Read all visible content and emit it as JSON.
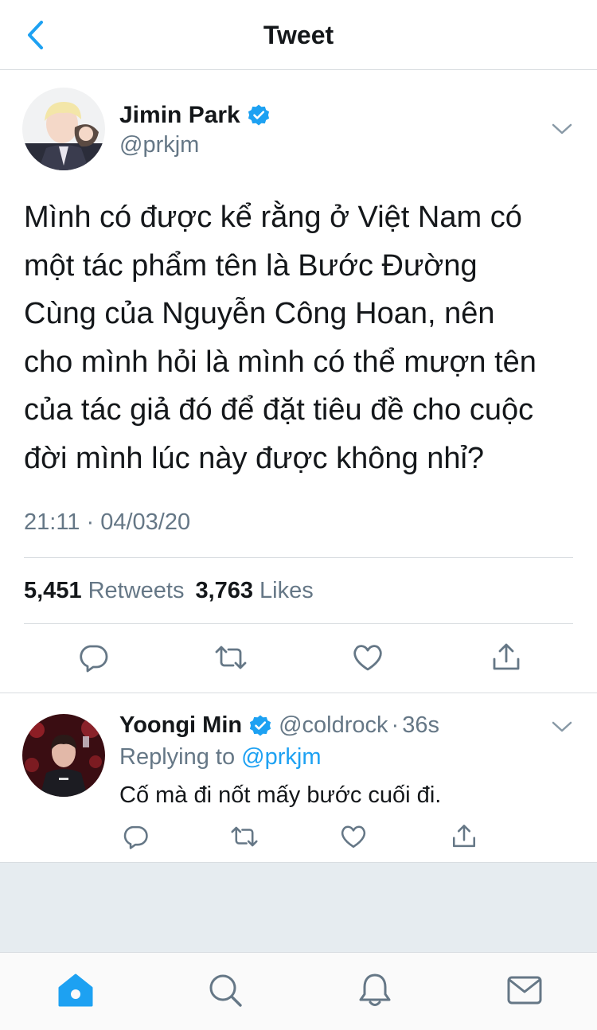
{
  "header": {
    "title": "Tweet"
  },
  "colors": {
    "accent": "#1da1f2",
    "text": "#14171a",
    "muted": "#657786",
    "divider": "#d9dde1",
    "background_gray": "#e6ecf0"
  },
  "tweet": {
    "author_name": "Jimin Park",
    "author_handle": "@prkjm",
    "verified": true,
    "lines": [
      "Mình có được kể rằng ở Việt Nam có",
      "một tác phẩm tên là Bước Đường",
      "Cùng của Nguyễn Công Hoan, nên",
      "cho mình hỏi là mình có thể mượn tên",
      "của tác giả đó để đặt tiêu đề cho cuộc",
      "đời mình lúc này được không nhỉ?"
    ],
    "timestamp": "21:11 · 04/03/20",
    "retweet_count": "5,451",
    "retweet_label": "Retweets",
    "like_count": "3,763",
    "like_label": "Likes"
  },
  "reply": {
    "author_name": "Yoongi Min",
    "author_handle": "@coldrock",
    "separator": "·",
    "time": "36s",
    "replying_prefix": "Replying to",
    "replying_to": "@prkjm",
    "text": "Cố mà đi nốt mấy bước cuối đi."
  },
  "icons": [
    "back-chevron-icon",
    "verified-badge-icon",
    "caret-down-icon",
    "reply-icon",
    "retweet-icon",
    "like-icon",
    "share-icon",
    "home-icon",
    "search-icon",
    "notifications-icon",
    "messages-icon"
  ]
}
